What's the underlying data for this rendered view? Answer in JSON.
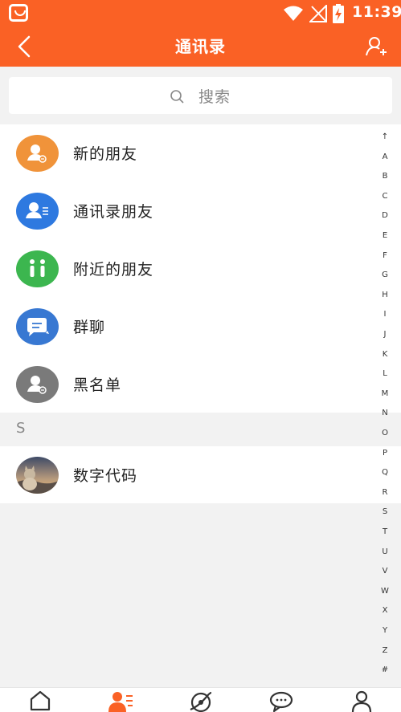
{
  "status_bar": {
    "time": "11:39",
    "icons": [
      "app-icon",
      "wifi-icon",
      "no-signal-icon",
      "battery-charging-icon"
    ]
  },
  "header": {
    "title": "通讯录",
    "back_icon": "chevron-left-icon",
    "add_icon": "add-user-icon"
  },
  "search": {
    "placeholder": "搜索",
    "icon": "search-icon"
  },
  "menu": [
    {
      "label": "新的朋友",
      "icon": "user-add-icon",
      "color": "#f0933a"
    },
    {
      "label": "通讯录朋友",
      "icon": "contact-list-icon",
      "color": "#2e79e0"
    },
    {
      "label": "附近的朋友",
      "icon": "people-nearby-icon",
      "color": "#3cb64f"
    },
    {
      "label": "群聊",
      "icon": "chat-bubble-icon",
      "color": "#3878d2"
    },
    {
      "label": "黑名单",
      "icon": "user-blocked-icon",
      "color": "#7a7a7a"
    }
  ],
  "section": {
    "letter": "S"
  },
  "contacts": [
    {
      "name": "数字代码",
      "avatar": "cat-photo-avatar"
    }
  ],
  "index_letters": [
    "↑",
    "A",
    "B",
    "C",
    "D",
    "E",
    "F",
    "G",
    "H",
    "I",
    "J",
    "K",
    "L",
    "M",
    "N",
    "O",
    "P",
    "Q",
    "R",
    "S",
    "T",
    "U",
    "V",
    "W",
    "X",
    "Y",
    "Z",
    "#"
  ],
  "bottom_nav": {
    "tabs": [
      {
        "icon": "home-icon",
        "active": false
      },
      {
        "icon": "contacts-icon",
        "active": true
      },
      {
        "icon": "discover-icon",
        "active": false
      },
      {
        "icon": "messages-icon",
        "active": false
      },
      {
        "icon": "profile-icon",
        "active": false
      }
    ],
    "active_color": "#fa6125",
    "inactive_color": "#333333"
  },
  "colors": {
    "brand": "#fa6125",
    "background": "#f2f2f2"
  }
}
